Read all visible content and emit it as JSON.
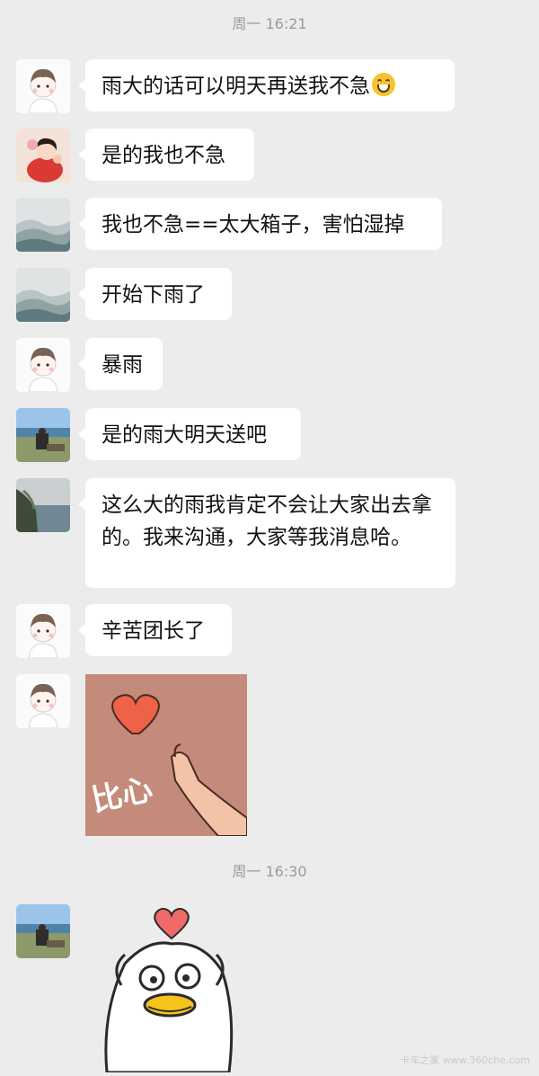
{
  "chat": {
    "timestamp_1": "周一 16:21",
    "timestamp_2": "周一 16:30",
    "messages": [
      {
        "text": "雨大的话可以明天再送我不急",
        "emoji": "grinning-face-emoji"
      },
      {
        "text": "是的我也不急"
      },
      {
        "text": "我也不急==太大箱子，害怕湿掉"
      },
      {
        "text": "开始下雨了"
      },
      {
        "text": "暴雨"
      },
      {
        "text": "是的雨大明天送吧"
      },
      {
        "text": "这么大的雨我肯定不会让大家出去拿的。我来沟通，大家等我消息哈。"
      },
      {
        "text": "辛苦团长了"
      }
    ],
    "sticker_1": {
      "text": "比心",
      "icon": "heart-finger-sticker"
    },
    "sticker_2": {
      "icon": "duck-heart-sticker"
    }
  },
  "watermark": "卡车之家 www.360che.com",
  "colors": {
    "background": "#ececec",
    "bubble": "#ffffff",
    "timestamp": "#9a9a9a"
  }
}
